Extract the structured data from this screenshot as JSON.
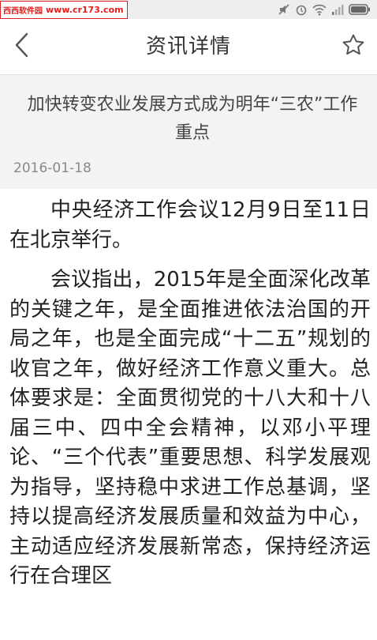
{
  "watermark": {
    "name": "西西软件园",
    "url": "www.cr173.com"
  },
  "header": {
    "title": "资讯详情"
  },
  "article": {
    "title": "加快转变农业发展方式成为明年“三农”工作重点",
    "date": "2016-01-18",
    "paragraphs": [
      "中央经济工作会议12月9日至11日在北京举行。",
      "会议指出，2015年是全面深化改革的关键之年，是全面推进依法治国的开局之年，也是全面完成“十二五”规划的收官之年，做好经济工作意义重大。总体要求是：全面贯彻党的十八大和十八届三中、四中全会精神，以邓小平理论、“三个代表”重要思想、科学发展观为指导，坚持稳中求进工作总基调，坚持以提高经济发展质量和效益为中心，主动适应经济发展新常态，保持经济运行在合理区"
    ]
  },
  "colors": {
    "accent": "#333333",
    "watermark_red": "#e02020",
    "head_bg": "#f3f3f3"
  },
  "icons": [
    "back-arrow-icon",
    "star-outline-icon",
    "mute-icon",
    "alarm-icon",
    "wifi-icon",
    "signal-icon",
    "battery-icon"
  ]
}
